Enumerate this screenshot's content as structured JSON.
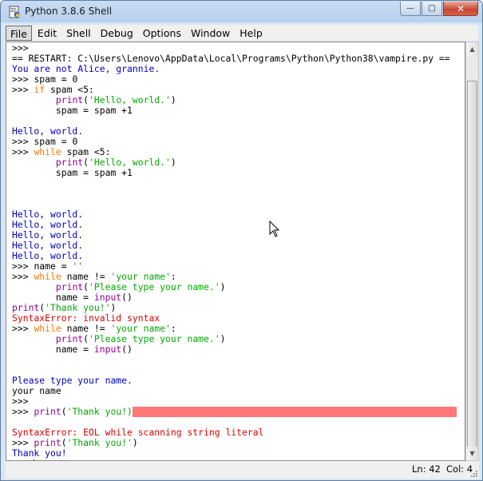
{
  "window": {
    "title": "Python 3.8.6 Shell",
    "minimize_glyph": "—",
    "maximize_glyph": "□",
    "close_glyph": "✕"
  },
  "menu": [
    "File",
    "Edit",
    "Shell",
    "Debug",
    "Options",
    "Window",
    "Help"
  ],
  "shell": {
    "lines": [
      [
        {
          "t": ">>> ",
          "c": "c-black"
        }
      ],
      [
        {
          "t": "== RESTART: C:\\Users\\Lenovo\\AppData\\Local\\Programs\\Python\\Python38\\vampire.py ==",
          "c": "c-black"
        }
      ],
      [
        {
          "t": "You are not Alice, grannie.",
          "c": "c-blue"
        }
      ],
      [
        {
          "t": ">>> ",
          "c": "c-black"
        },
        {
          "t": "spam = 0",
          "c": "c-black"
        }
      ],
      [
        {
          "t": ">>> ",
          "c": "c-black"
        },
        {
          "t": "if",
          "c": "c-orange"
        },
        {
          "t": " spam <5:",
          "c": "c-black"
        }
      ],
      [
        {
          "t": "        ",
          "c": "c-black"
        },
        {
          "t": "print",
          "c": "c-purple"
        },
        {
          "t": "(",
          "c": "c-black"
        },
        {
          "t": "'Hello, world.'",
          "c": "c-green"
        },
        {
          "t": ")",
          "c": "c-black"
        }
      ],
      [
        {
          "t": "        spam = spam +1",
          "c": "c-black"
        }
      ],
      [
        {
          "t": "",
          "c": "c-black"
        }
      ],
      [
        {
          "t": "Hello, world.",
          "c": "c-blue"
        }
      ],
      [
        {
          "t": ">>> ",
          "c": "c-black"
        },
        {
          "t": "spam = 0",
          "c": "c-black"
        }
      ],
      [
        {
          "t": ">>> ",
          "c": "c-black"
        },
        {
          "t": "while",
          "c": "c-orange"
        },
        {
          "t": " spam <5:",
          "c": "c-black"
        }
      ],
      [
        {
          "t": "        ",
          "c": "c-black"
        },
        {
          "t": "print",
          "c": "c-purple"
        },
        {
          "t": "(",
          "c": "c-black"
        },
        {
          "t": "'Hello, world.'",
          "c": "c-green"
        },
        {
          "t": ")",
          "c": "c-black"
        }
      ],
      [
        {
          "t": "        spam = spam +1",
          "c": "c-black"
        }
      ],
      [
        {
          "t": "",
          "c": "c-black"
        }
      ],
      [
        {
          "t": "",
          "c": "c-black"
        }
      ],
      [
        {
          "t": "",
          "c": "c-black"
        }
      ],
      [
        {
          "t": "Hello, world.",
          "c": "c-blue"
        }
      ],
      [
        {
          "t": "Hello, world.",
          "c": "c-blue"
        }
      ],
      [
        {
          "t": "Hello, world.",
          "c": "c-blue"
        }
      ],
      [
        {
          "t": "Hello, world.",
          "c": "c-blue"
        }
      ],
      [
        {
          "t": "Hello, world.",
          "c": "c-blue"
        }
      ],
      [
        {
          "t": ">>> ",
          "c": "c-black"
        },
        {
          "t": "name = ",
          "c": "c-black"
        },
        {
          "t": "''",
          "c": "c-green"
        }
      ],
      [
        {
          "t": ">>> ",
          "c": "c-black"
        },
        {
          "t": "while",
          "c": "c-orange"
        },
        {
          "t": " name != ",
          "c": "c-black"
        },
        {
          "t": "'your name'",
          "c": "c-green"
        },
        {
          "t": ":",
          "c": "c-black"
        }
      ],
      [
        {
          "t": "        ",
          "c": "c-black"
        },
        {
          "t": "print",
          "c": "c-purple"
        },
        {
          "t": "(",
          "c": "c-black"
        },
        {
          "t": "'Please type your name.'",
          "c": "c-green"
        },
        {
          "t": ")",
          "c": "c-black"
        }
      ],
      [
        {
          "t": "        name = ",
          "c": "c-black"
        },
        {
          "t": "input",
          "c": "c-purple"
        },
        {
          "t": "()",
          "c": "c-black"
        }
      ],
      [
        {
          "t": "print",
          "c": "c-purple"
        },
        {
          "t": "(",
          "c": "c-black"
        },
        {
          "t": "'Thank you!'",
          "c": "c-green"
        },
        {
          "t": ")",
          "c": "c-black"
        }
      ],
      [
        {
          "t": "SyntaxError: invalid syntax",
          "c": "c-red"
        }
      ],
      [
        {
          "t": ">>> ",
          "c": "c-black"
        },
        {
          "t": "while",
          "c": "c-orange"
        },
        {
          "t": " name != ",
          "c": "c-black"
        },
        {
          "t": "'your name'",
          "c": "c-green"
        },
        {
          "t": ":",
          "c": "c-black"
        }
      ],
      [
        {
          "t": "        ",
          "c": "c-black"
        },
        {
          "t": "print",
          "c": "c-purple"
        },
        {
          "t": "(",
          "c": "c-black"
        },
        {
          "t": "'Please type your name.'",
          "c": "c-green"
        },
        {
          "t": ")",
          "c": "c-black"
        }
      ],
      [
        {
          "t": "        name = ",
          "c": "c-black"
        },
        {
          "t": "input",
          "c": "c-purple"
        },
        {
          "t": "()",
          "c": "c-black"
        }
      ],
      [
        {
          "t": "",
          "c": "c-black"
        }
      ],
      [
        {
          "t": "",
          "c": "c-black"
        }
      ],
      [
        {
          "t": "Please type your name.",
          "c": "c-blue"
        }
      ],
      [
        {
          "t": "your name",
          "c": "c-black"
        }
      ],
      [
        {
          "t": ">>> ",
          "c": "c-black"
        }
      ],
      [
        {
          "t": ">>> ",
          "c": "c-black"
        },
        {
          "t": "print",
          "c": "c-purple"
        },
        {
          "t": "(",
          "c": "c-black"
        },
        {
          "t": "'Thank you!)",
          "c": "c-green"
        },
        {
          "t": "",
          "c": "errhl"
        }
      ],
      [
        {
          "t": "",
          "c": "c-black"
        }
      ],
      [
        {
          "t": "SyntaxError: EOL while scanning string literal",
          "c": "c-red"
        }
      ],
      [
        {
          "t": ">>> ",
          "c": "c-black"
        },
        {
          "t": "print",
          "c": "c-purple"
        },
        {
          "t": "(",
          "c": "c-black"
        },
        {
          "t": "'Thank you!'",
          "c": "c-green"
        },
        {
          "t": ")",
          "c": "c-black"
        }
      ],
      [
        {
          "t": "Thank you!",
          "c": "c-blue"
        }
      ],
      [
        {
          "t": ">>> ",
          "c": "c-black"
        },
        {
          "t": "",
          "c": "caret"
        }
      ]
    ]
  },
  "status": {
    "line": "Ln: 42",
    "col": "Col: 4"
  }
}
